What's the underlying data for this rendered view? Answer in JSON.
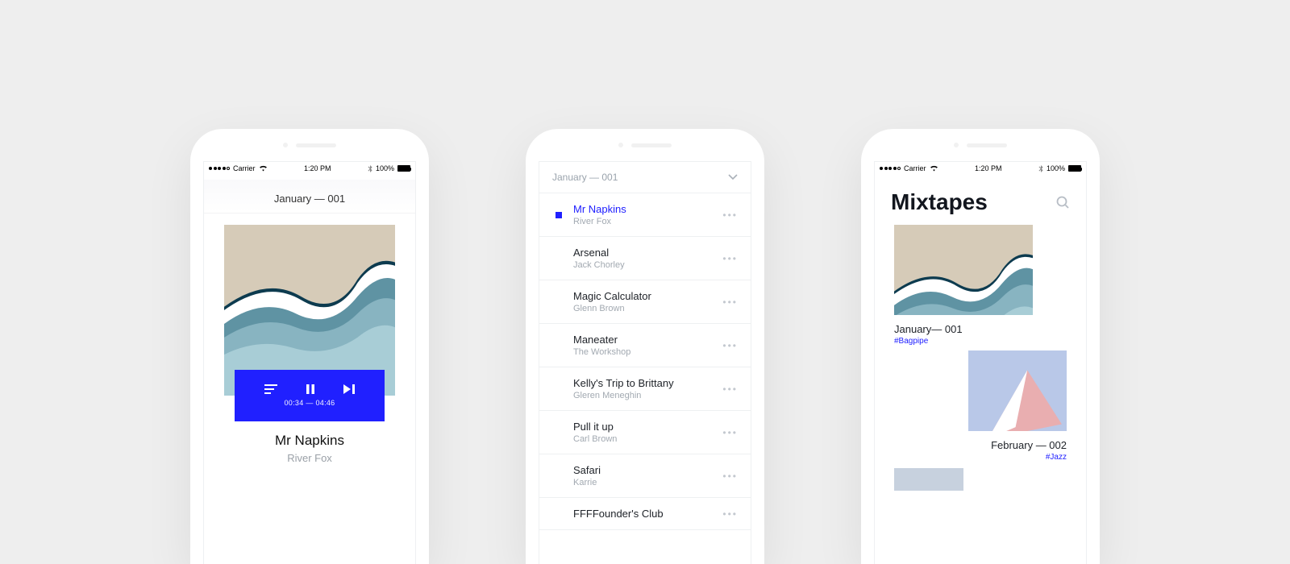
{
  "statusbar": {
    "carrier": "Carrier",
    "time": "1:20 PM",
    "battery": "100%"
  },
  "now_playing": {
    "header": "January — 001",
    "elapsed": "00:34",
    "separator": "—",
    "duration": "04:46",
    "title": "Mr Napkins",
    "artist": "River Fox"
  },
  "playlist": {
    "header": "January — 001",
    "tracks": [
      {
        "title": "Mr Napkins",
        "artist": "River Fox",
        "playing": true
      },
      {
        "title": "Arsenal",
        "artist": "Jack Chorley",
        "playing": false
      },
      {
        "title": "Magic Calculator",
        "artist": "Glenn Brown",
        "playing": false
      },
      {
        "title": "Maneater",
        "artist": "The Workshop",
        "playing": false
      },
      {
        "title": "Kelly's Trip to Brittany",
        "artist": "Gleren Meneghin",
        "playing": false
      },
      {
        "title": "Pull it up",
        "artist": "Carl Brown",
        "playing": false
      },
      {
        "title": "Safari",
        "artist": "Karrie",
        "playing": false
      },
      {
        "title": "FFFFounder's Club",
        "artist": "",
        "playing": false
      }
    ]
  },
  "mixtapes": {
    "title": "Mixtapes",
    "items": [
      {
        "label": "January— 001",
        "tag": "#Bagpipe"
      },
      {
        "label": "February — 002",
        "tag": "#Jazz"
      }
    ]
  }
}
